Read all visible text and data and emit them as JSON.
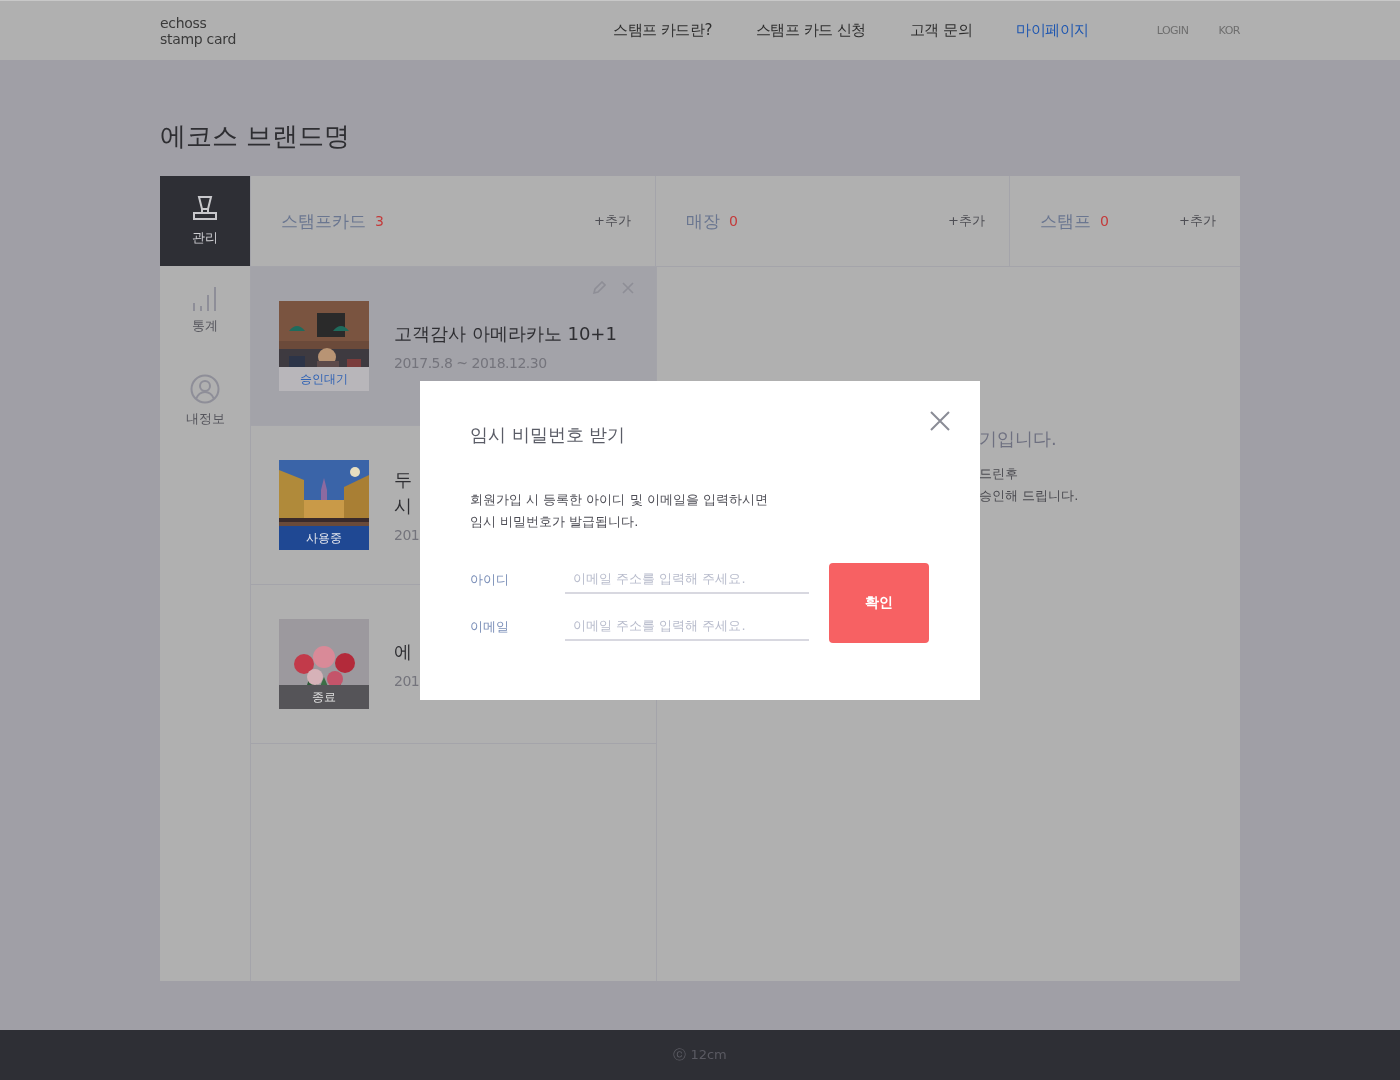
{
  "header": {
    "logo": [
      "echoss",
      "stamp card"
    ],
    "nav": [
      {
        "label": "스탬프 카드란?",
        "selected": false
      },
      {
        "label": "스탬프 카드 신청",
        "selected": false
      },
      {
        "label": "고객 문의",
        "selected": false
      },
      {
        "label": "마이페이지",
        "selected": true
      }
    ],
    "utility": [
      "LOGIN",
      "KOR"
    ]
  },
  "page_title": "에코스 브랜드명",
  "sidebar": [
    {
      "label": "관리",
      "selected": true
    },
    {
      "label": "통계",
      "selected": false
    },
    {
      "label": "내정보",
      "selected": false
    }
  ],
  "columns": [
    {
      "title": "스탬프카드",
      "count": "3",
      "add": "+추가"
    },
    {
      "title": "매장",
      "count": "0",
      "add": "+추가"
    },
    {
      "title": "스탬프",
      "count": "0",
      "add": "+추가"
    }
  ],
  "cards": [
    {
      "title_lines": [
        "고객감사 아메라카노 10+1"
      ],
      "date": "2017.5.8 ~ 2018.12.30",
      "status": "승인대기",
      "kind": "pending",
      "selected": true
    },
    {
      "title_lines": [
        "두",
        "시"
      ],
      "date": "201",
      "status": "사용중",
      "kind": "active",
      "selected": false
    },
    {
      "title_lines": [
        "에"
      ],
      "date": "201",
      "status": "종료",
      "kind": "ended",
      "selected": false
    }
  ],
  "notice": {
    "heading": "기입니다.",
    "lines": [
      "드린후",
      "승인해 드립니다."
    ]
  },
  "modal": {
    "title": "임시 비밀번호 받기",
    "description": [
      "회원가입 시 등록한 아이디 및 이메일을 입력하시면",
      "임시 비밀번호가 발급됩니다."
    ],
    "fields": [
      {
        "label": "아이디",
        "placeholder": "이메일 주소를 입력해 주세요."
      },
      {
        "label": "이메일",
        "placeholder": "이메일 주소를 입력해 주세요."
      }
    ],
    "confirm": "확인"
  },
  "footer": "ⓒ 12cm"
}
